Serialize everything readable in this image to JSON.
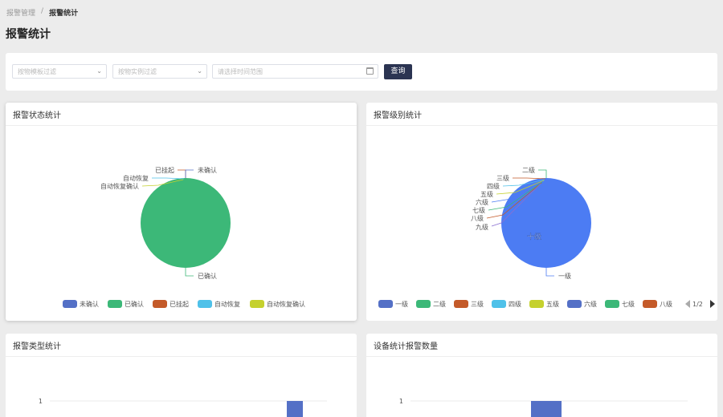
{
  "breadcrumb": {
    "parent": "报警管理",
    "separator": "/",
    "current": "报警统计"
  },
  "page_title": "报警统计",
  "filters": {
    "template_placeholder": "按物模板过滤",
    "instance_placeholder": "按物实例过滤",
    "date_placeholder": "请选择时间范围",
    "query_label": "查询"
  },
  "cards": {
    "status": {
      "title": "报警状态统计"
    },
    "level": {
      "title": "报警级别统计"
    },
    "type": {
      "title": "报警类型统计"
    },
    "device": {
      "title": "设备统计报警数量"
    }
  },
  "chart_data": [
    {
      "type": "pie",
      "title": "报警状态统计",
      "labels": [
        "未确认",
        "已确认",
        "已挂起",
        "自动恢复",
        "自动恢复确认"
      ],
      "values": [
        0,
        1,
        0,
        0,
        0
      ],
      "colors": [
        "#5470c6",
        "#3cb878",
        "#c45a29",
        "#4fc1e9",
        "#c5d12e"
      ],
      "legend": "bottom"
    },
    {
      "type": "pie",
      "title": "报警级别统计",
      "labels": [
        "一级",
        "二级",
        "三级",
        "四级",
        "五级",
        "六级",
        "七级",
        "八级",
        "九级",
        "十级"
      ],
      "values": [
        0,
        0,
        0,
        0,
        0,
        0,
        0,
        0,
        0,
        1
      ],
      "inner_label": "十级",
      "colors": [
        "#5470c6",
        "#3cb878",
        "#c45a29",
        "#4fc1e9",
        "#c5d12e",
        "#5470c6",
        "#3cb878",
        "#c45a29"
      ],
      "legend": "bottom",
      "legend_page": "1/2"
    },
    {
      "type": "bar",
      "title": "报警类型统计",
      "y_ticks": [
        1
      ],
      "values": [
        1
      ]
    },
    {
      "type": "bar",
      "title": "设备统计报警数量",
      "y_ticks": [
        1
      ],
      "values": [
        1
      ]
    }
  ]
}
